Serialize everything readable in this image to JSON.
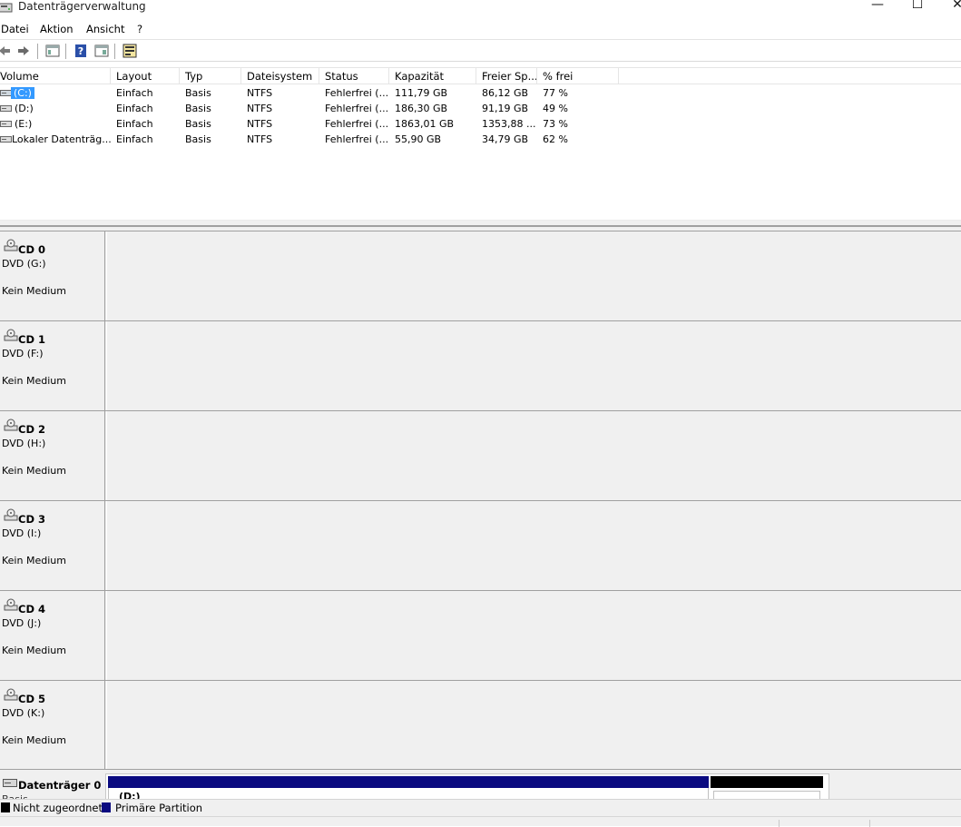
{
  "window": {
    "title": "Datenträgerverwaltung",
    "minimize": "—",
    "maximize": "☐",
    "close": "✕"
  },
  "menu": [
    "Datei",
    "Aktion",
    "Ansicht",
    "?"
  ],
  "toolbar": {
    "icons": [
      "back-arrow-icon",
      "forward-arrow-icon",
      "console-tree-icon",
      "help-icon",
      "properties-icon",
      "disk-settings-icon"
    ]
  },
  "volume_list": {
    "columns": [
      "Volume",
      "Layout",
      "Typ",
      "Dateisystem",
      "Status",
      "Kapazität",
      "Freier Sp...",
      "% frei"
    ],
    "rows": [
      {
        "volume": "(C:)",
        "layout": "Einfach",
        "typ": "Basis",
        "dateisystem": "NTFS",
        "status": "Fehlerfrei (...",
        "kapazitaet": "111,79 GB",
        "frei": "86,12 GB",
        "prozent": "77 %",
        "selected": true
      },
      {
        "volume": "(D:)",
        "layout": "Einfach",
        "typ": "Basis",
        "dateisystem": "NTFS",
        "status": "Fehlerfrei (...",
        "kapazitaet": "186,30 GB",
        "frei": "91,19 GB",
        "prozent": "49 %",
        "selected": false
      },
      {
        "volume": "(E:)",
        "layout": "Einfach",
        "typ": "Basis",
        "dateisystem": "NTFS",
        "status": "Fehlerfrei (...",
        "kapazitaet": "1863,01 GB",
        "frei": "1353,88 ...",
        "prozent": "73 %",
        "selected": false
      },
      {
        "volume": "Lokaler Datenträg...",
        "layout": "Einfach",
        "typ": "Basis",
        "dateisystem": "NTFS",
        "status": "Fehlerfrei (...",
        "kapazitaet": "55,90 GB",
        "frei": "34,79 GB",
        "prozent": "62 %",
        "selected": false
      }
    ]
  },
  "drives": [
    {
      "name": "CD 0",
      "type": "DVD (G:)",
      "medium": "Kein Medium"
    },
    {
      "name": "CD 1",
      "type": "DVD (F:)",
      "medium": "Kein Medium"
    },
    {
      "name": "CD 2",
      "type": "DVD (H:)",
      "medium": "Kein Medium"
    },
    {
      "name": "CD 3",
      "type": "DVD (I:)",
      "medium": "Kein Medium"
    },
    {
      "name": "CD 4",
      "type": "DVD (J:)",
      "medium": "Kein Medium"
    },
    {
      "name": "CD 5",
      "type": "DVD (K:)",
      "medium": "Kein Medium"
    }
  ],
  "disk0": {
    "name": "Datenträger 0",
    "type": "Basis",
    "partition_label": "(D:)"
  },
  "legend": [
    {
      "label": "Nicht zugeordnet",
      "color": "#000000"
    },
    {
      "label": "Primäre Partition",
      "color": "#0a0a80"
    }
  ]
}
